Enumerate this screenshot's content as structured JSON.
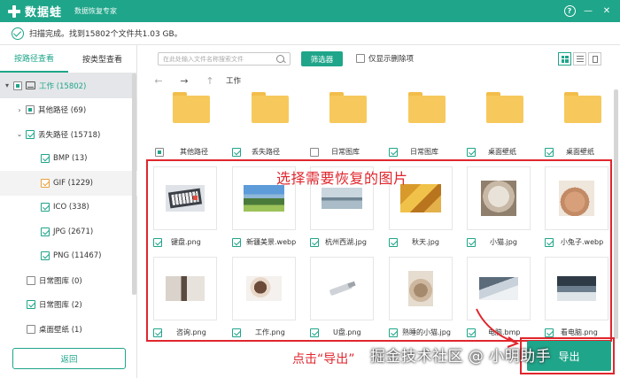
{
  "titlebar": {
    "app_name": "数据蛙",
    "subtitle": "数据恢复专家",
    "help_label": "?",
    "minimize_label": "—",
    "close_label": "✕"
  },
  "status": {
    "text": "扫描完成。找到15802个文件共1.03 GB。"
  },
  "left_tabs": [
    {
      "label": "按路径查看"
    },
    {
      "label": "按类型查看"
    }
  ],
  "tree": [
    {
      "label": "工作 (15802)"
    },
    {
      "label": "其他路径 (69)"
    },
    {
      "label": "丢失路径 (15718)"
    },
    {
      "label": "BMP (13)"
    },
    {
      "label": "GIF (1229)"
    },
    {
      "label": "ICO (338)"
    },
    {
      "label": "JPG (2671)"
    },
    {
      "label": "PNG (11467)"
    },
    {
      "label": "日常图库 (0)"
    },
    {
      "label": "日常图库 (2)"
    },
    {
      "label": "桌面壁纸 (1)"
    }
  ],
  "back_button": "返回",
  "toolbar": {
    "search_placeholder": "在此处输入文件名称搜索文件",
    "filter_label": "筛选器",
    "only_deleted_label": "仅显示删除项"
  },
  "path": {
    "current": "工作",
    "back_glyph": "←",
    "forward_glyph": "→",
    "up_glyph": "↑"
  },
  "folders": [
    {
      "label": "其他路径",
      "checked": "partial"
    },
    {
      "label": "丢失路径",
      "checked": "true"
    },
    {
      "label": "日常图库",
      "checked": "false"
    },
    {
      "label": "日常图库",
      "checked": "true"
    },
    {
      "label": "桌面壁纸",
      "checked": "true"
    },
    {
      "label": "桌面壁纸",
      "checked": "true"
    }
  ],
  "files_row1": [
    {
      "label": "键盘.png"
    },
    {
      "label": "新疆美景.webp"
    },
    {
      "label": "杭州西湖.jpg"
    },
    {
      "label": "秋天.jpg"
    },
    {
      "label": "小猫.jpg"
    },
    {
      "label": "小兔子.webp"
    }
  ],
  "files_row2": [
    {
      "label": "咨询.png"
    },
    {
      "label": "工作.png"
    },
    {
      "label": "U盘.png"
    },
    {
      "label": "熟睡的小猫.jpg"
    },
    {
      "label": "电脑.bmp"
    },
    {
      "label": "看电脑.png"
    }
  ],
  "annotations": {
    "select_hint": "选择需要恢复的图片",
    "click_hint": "点击“导出”"
  },
  "export_button": "导出",
  "watermark": "掘金技术社区 @ 小明助手",
  "colors": {
    "brand": "#1fa58a",
    "annotation_red": "#e0262d",
    "folder": "#f7c95c"
  }
}
